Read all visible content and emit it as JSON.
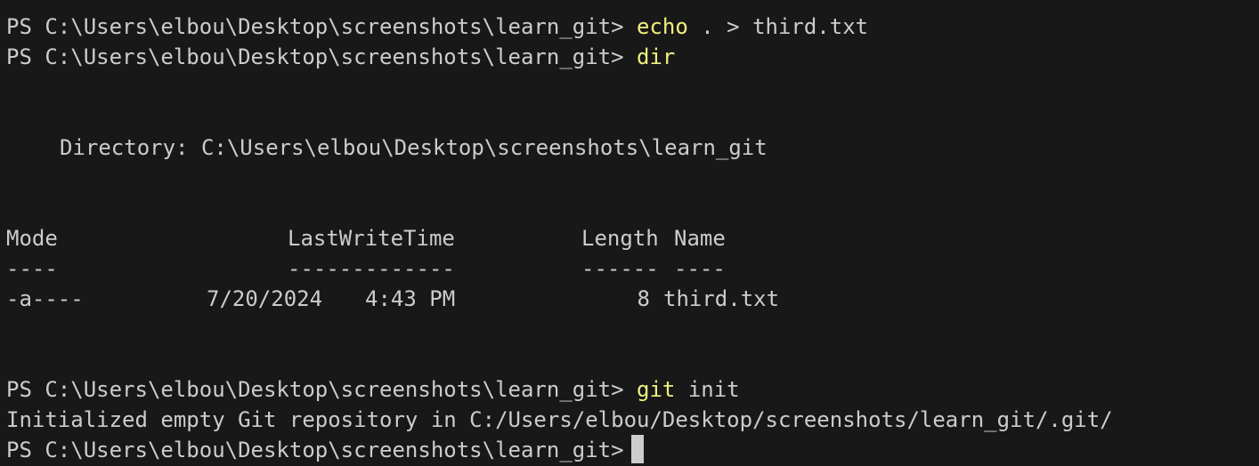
{
  "terminal": {
    "prompt": "PS C:\\Users\\elbou\\Desktop\\screenshots\\learn_git>",
    "commands": [
      {
        "cmd": "echo",
        "args": ". > third.txt"
      },
      {
        "cmd": "dir",
        "args": ""
      },
      {
        "cmd": "git",
        "args": "init"
      }
    ],
    "directory_line": "Directory: C:\\Users\\elbou\\Desktop\\screenshots\\learn_git",
    "table": {
      "headers": {
        "mode": "Mode",
        "last_write_time": "LastWriteTime",
        "length": "Length",
        "name": "Name"
      },
      "underlines": {
        "mode": "----",
        "last_write_time": "-------------",
        "length": "------",
        "name": "----"
      },
      "rows": [
        {
          "mode": "-a----",
          "date": "7/20/2024",
          "time": "4:43 PM",
          "length": "8",
          "name": "third.txt"
        }
      ]
    },
    "git_init_output": "Initialized empty Git repository in C:/Users/elbou/Desktop/screenshots/learn_git/.git/"
  }
}
